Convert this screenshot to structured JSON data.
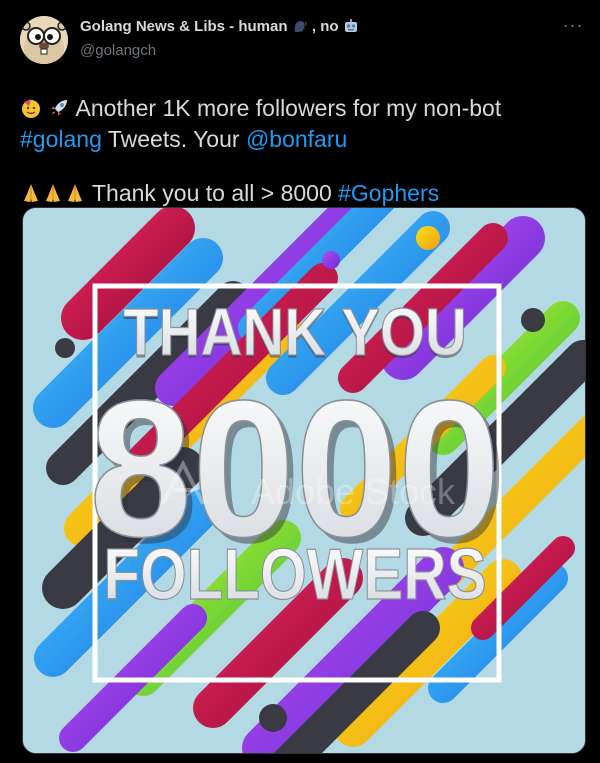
{
  "author": {
    "display_name": "Golang News & Libs - human",
    "name_suffix": ", no",
    "handle": "@golangch"
  },
  "menu": {
    "more_label": "···"
  },
  "tweet": {
    "line1": "Another 1K more followers for my non-bot",
    "hashtag_golang": "#golang",
    "line2_mid": "Tweets. Your",
    "mention": "@bonfaru",
    "line3_pre": "Thank you to all > 8000",
    "hashtag_gophers": "#Gophers"
  },
  "image": {
    "title_top": "THANK YOU",
    "number": "8000",
    "title_bottom": "FOLLOWERS",
    "watermark": "Adobe Stock"
  },
  "icons": {
    "avatar": "gopher-avatar",
    "speaking_head": "speaking-head-icon",
    "robot": "robot-icon",
    "party": "party-face-icon",
    "rocket": "rocket-icon",
    "pray": "folded-hands-icon"
  },
  "colors": {
    "background": "#000000",
    "link": "#1d9bf0",
    "text": "#d9d9d9",
    "muted": "#6e767d",
    "image_bg": "#b3d9e4"
  }
}
